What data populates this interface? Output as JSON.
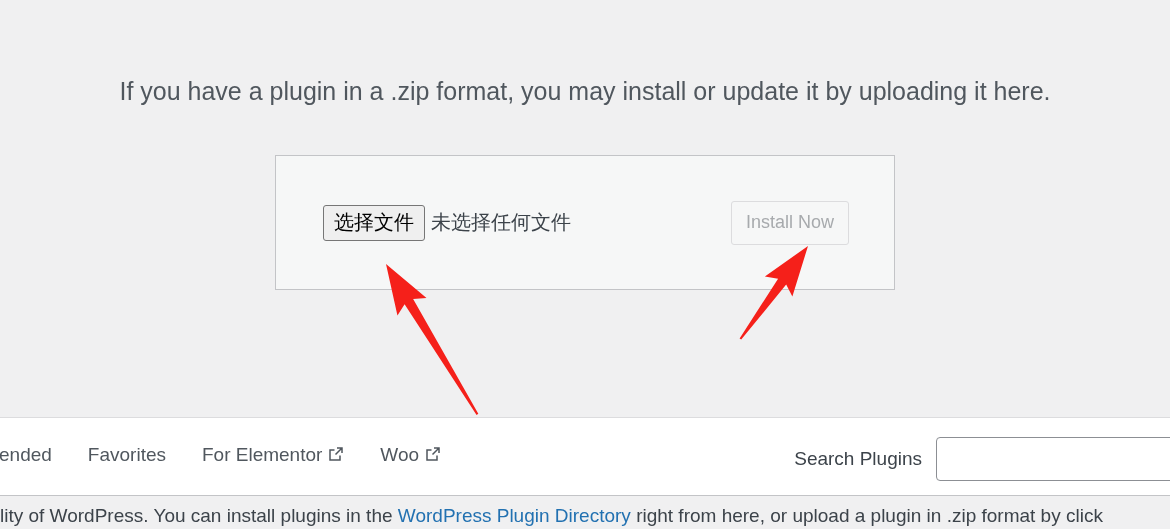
{
  "intro": "If you have a plugin in a .zip format, you may install or update it by uploading it here.",
  "upload": {
    "file_button": "选择文件",
    "file_status": "未选择任何文件",
    "install_button": {
      "label": "Install Now",
      "disabled": true
    }
  },
  "tabs": [
    {
      "label": "ended",
      "selected": false,
      "kind": "plain"
    },
    {
      "label": "Favorites",
      "selected": false,
      "kind": "plain"
    },
    {
      "label": "For Elementor",
      "selected": false,
      "kind": "external"
    },
    {
      "label": "Woo",
      "selected": false,
      "kind": "external"
    }
  ],
  "search": {
    "label": "Search Plugins"
  },
  "description": {
    "before": "lity of WordPress. You can install plugins in the",
    "link": "WordPress Plugin Directory",
    "after": "right from here, or upload a plugin in .zip format by click"
  }
}
